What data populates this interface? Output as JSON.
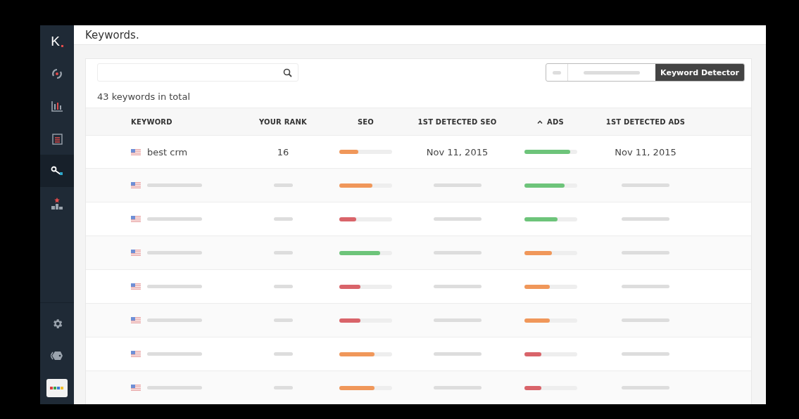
{
  "sidebar": {
    "logo": "K",
    "items": [
      {
        "kind": "gauge",
        "selected": false
      },
      {
        "kind": "chart",
        "selected": false
      },
      {
        "kind": "calendar",
        "selected": false
      },
      {
        "kind": "key",
        "selected": true
      },
      {
        "kind": "podium",
        "selected": false
      }
    ],
    "bottom_items": [
      {
        "kind": "settings",
        "selected": false
      },
      {
        "kind": "tags",
        "selected": false
      },
      {
        "kind": "logo",
        "selected": false
      }
    ]
  },
  "header": {
    "title": "Keywords."
  },
  "toolbar": {
    "detector_button": "Keyword Detector"
  },
  "summary": "43 keywords in total",
  "table": {
    "columns": [
      {
        "label": "KEYWORD",
        "sorted": false
      },
      {
        "label": "YOUR RANK",
        "sorted": false
      },
      {
        "label": "SEO",
        "sorted": false
      },
      {
        "label": "1ST DETECTED SEO",
        "sorted": false
      },
      {
        "label": "ADS",
        "sorted": true
      },
      {
        "label": "1ST DETECTED ADS",
        "sorted": false
      }
    ],
    "rows": [
      {
        "kind": "filled",
        "keyword": "best crm",
        "rank": "16",
        "seo": {
          "level": 0.36,
          "color": "#f0975a"
        },
        "seo_date": "Nov 11, 2015",
        "ads": {
          "level": 0.87,
          "color": "#6dc47a"
        },
        "ads_date": "Nov 11, 2015"
      },
      {
        "kind": "skeleton",
        "seo": {
          "level": 0.63,
          "color": "#f0975a"
        },
        "ads": {
          "level": 0.76,
          "color": "#6dc47a"
        }
      },
      {
        "kind": "skeleton",
        "seo": {
          "level": 0.32,
          "color": "#d9646a"
        },
        "ads": {
          "level": 0.63,
          "color": "#6dc47a"
        }
      },
      {
        "kind": "skeleton",
        "seo": {
          "level": 0.77,
          "color": "#6dc47a"
        },
        "ads": {
          "level": 0.53,
          "color": "#f0975a"
        }
      },
      {
        "kind": "skeleton",
        "seo": {
          "level": 0.4,
          "color": "#d9646a"
        },
        "ads": {
          "level": 0.49,
          "color": "#f0975a"
        }
      },
      {
        "kind": "skeleton",
        "seo": {
          "level": 0.4,
          "color": "#d9646a"
        },
        "ads": {
          "level": 0.49,
          "color": "#f0975a"
        }
      },
      {
        "kind": "skeleton",
        "seo": {
          "level": 0.67,
          "color": "#f0975a"
        },
        "ads": {
          "level": 0.32,
          "color": "#d9646a"
        }
      },
      {
        "kind": "skeleton",
        "seo": {
          "level": 0.67,
          "color": "#f0975a"
        },
        "ads": {
          "level": 0.32,
          "color": "#d9646a"
        }
      }
    ]
  }
}
